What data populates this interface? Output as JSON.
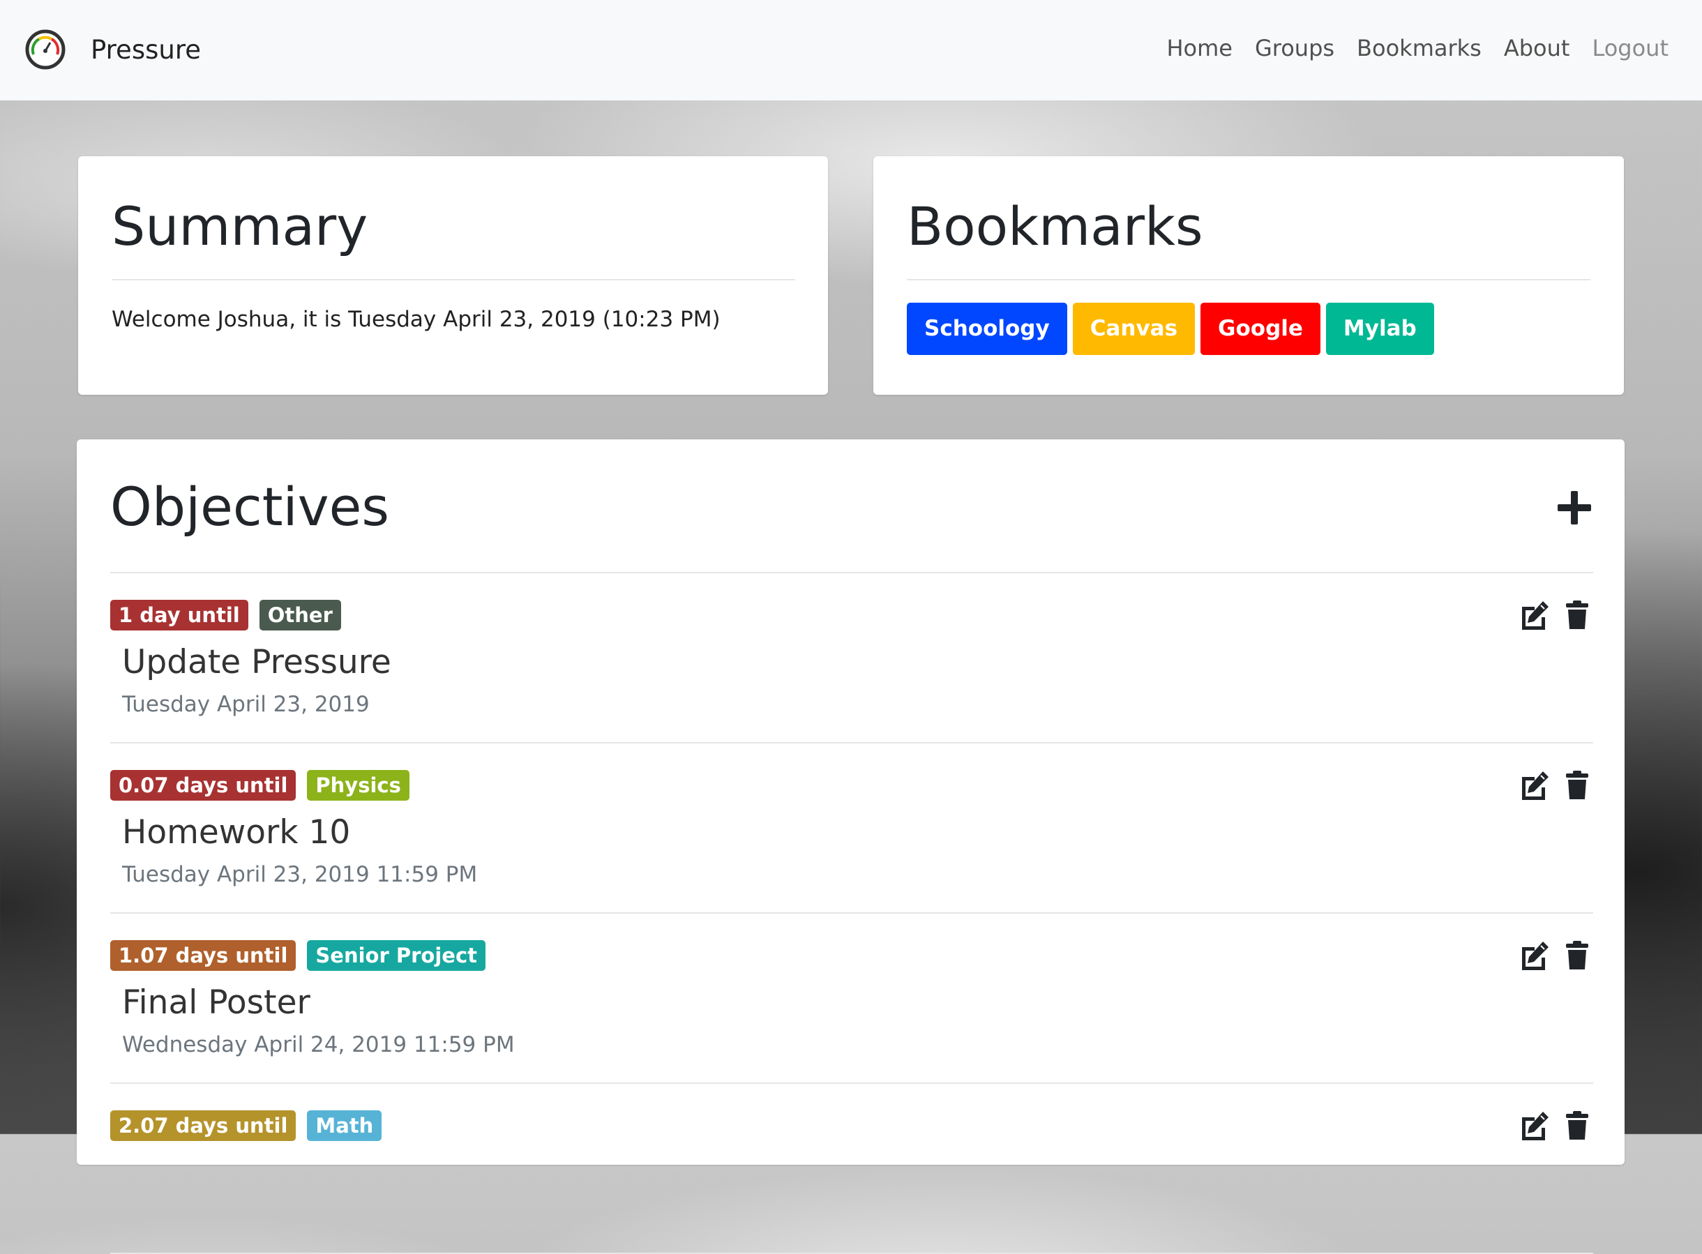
{
  "navbar": {
    "brand": "Pressure",
    "links": [
      "Home",
      "Groups",
      "Bookmarks",
      "About",
      "Logout"
    ]
  },
  "summary": {
    "title": "Summary",
    "welcome": "Welcome Joshua, it is Tuesday April 23, 2019 (10:23 PM)"
  },
  "bookmarks": {
    "title": "Bookmarks",
    "items": [
      {
        "label": "Schoology",
        "color": "#0047ff"
      },
      {
        "label": "Canvas",
        "color": "#ffb900"
      },
      {
        "label": "Google",
        "color": "#ff0000"
      },
      {
        "label": "Mylab",
        "color": "#00b894"
      }
    ]
  },
  "objectives": {
    "title": "Objectives",
    "add_icon": "plus-icon",
    "items": [
      {
        "due": "1 day until",
        "due_color": "#a83232",
        "group": "Other",
        "group_color": "#4a5a4f",
        "title": "Update Pressure",
        "date": "Tuesday April 23, 2019"
      },
      {
        "due": "0.07 days until",
        "due_color": "#a83232",
        "group": "Physics",
        "group_color": "#8cb31a",
        "title": "Homework 10",
        "date": "Tuesday April 23, 2019 11:59 PM"
      },
      {
        "due": "1.07 days until",
        "due_color": "#b0602c",
        "group": "Senior Project",
        "group_color": "#16a8a0",
        "title": "Final Poster",
        "date": "Wednesday April 24, 2019 11:59 PM"
      },
      {
        "due": "2.07 days until",
        "due_color": "#b5932b",
        "group": "Math",
        "group_color": "#56b3d6",
        "title": "",
        "date": ""
      }
    ]
  }
}
